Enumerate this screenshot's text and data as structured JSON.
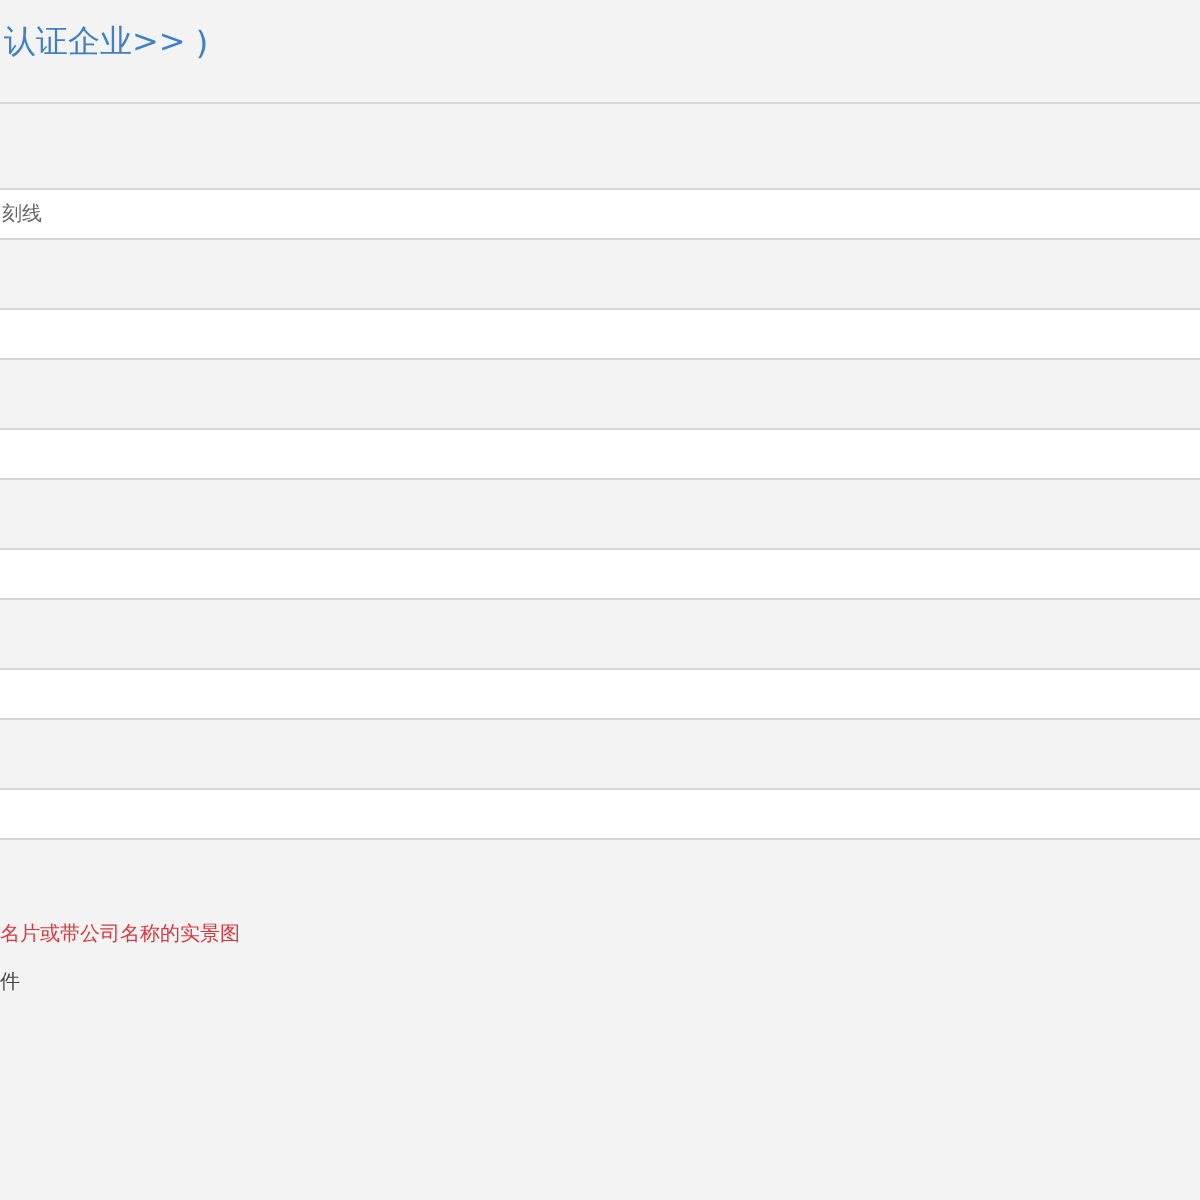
{
  "title": {
    "link": "认证企业>>",
    "suffix": " )"
  },
  "fields": [
    {
      "kind": "input",
      "placeholder": "刻线"
    },
    {
      "kind": "input"
    },
    {
      "kind": "input"
    },
    {
      "kind": "input"
    },
    {
      "kind": "input"
    },
    {
      "kind": "input"
    }
  ],
  "notes": [
    {
      "kind": "warning",
      "text": "名片或带公司名称的实景图"
    },
    {
      "kind": "plain",
      "text": "件"
    }
  ]
}
